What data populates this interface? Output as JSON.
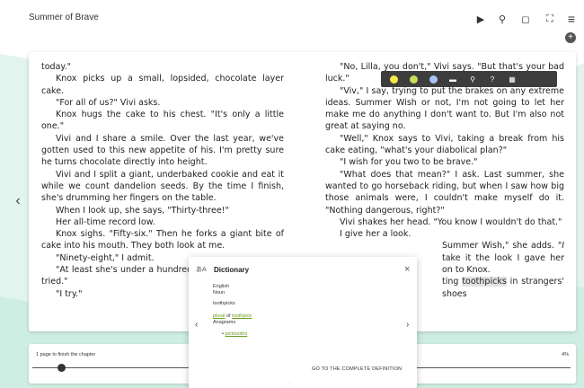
{
  "header": {
    "book_title": "Summer of Brave",
    "icons": [
      "play-icon",
      "search-icon",
      "bookmark-icon",
      "fullscreen-icon",
      "menu-icon"
    ],
    "play_glyph": "▶",
    "search_glyph": "⚲",
    "bookmark_glyph": "◻",
    "fullscreen_glyph": "⛶",
    "menu_glyph": "≡",
    "add_glyph": "+"
  },
  "nav": {
    "prev_glyph": "‹"
  },
  "left_column": [
    {
      "text": "today.\"",
      "noindent": true
    },
    {
      "text": "Knox picks up a small, lopsided, chocolate layer cake."
    },
    {
      "text": "\"For all of us?\" Vivi asks."
    },
    {
      "text": "Knox hugs the cake to his chest. \"It's only a little one.\""
    },
    {
      "text": "Vivi and I share a smile. Over the last year, we've gotten used to this new appetite of his. I'm pretty sure he turns chocolate directly into height."
    },
    {
      "text": "Vivi and I split a giant, underbaked cookie and eat it while we count dandelion seeds. By the time I finish, she's drumming her fingers on the table."
    },
    {
      "text": "When I look up, she says, \"Thirty-three!\""
    },
    {
      "text": "Her all-time record low."
    },
    {
      "text": "Knox sighs. \"Fifty-six.\" Then he forks a giant bite of cake into his mouth. They both look at me."
    },
    {
      "text": "\"Ninety-eight,\" I admit."
    },
    {
      "text": "\"At least she's under a hundred\" \"It's almost like she tried.\""
    },
    {
      "text": "\"I try.\""
    }
  ],
  "right_column": {
    "p1": "\"No, Lilla, you don't,\" Vivi says. \"But that's your bad luck.\"",
    "p2": "\"Viv,\" I say, trying to put the brakes on any extreme ideas. Summer Wish or not, I'm not going to let her make me do anything I don't want to. But I'm also not great at saying no.",
    "p3": "\"Well,\" Knox says to Vivi, taking a break from his cake eating, \"what's your diabolical plan?\"",
    "p4": "\"I wish for you two to be brave.\"",
    "p5": "\"What does that mean?\" I ask. Last summer, she wanted to go horseback riding, but when I saw how big those animals were, I couldn't make myself do it. \"Nothing dangerous, right?\"",
    "p6": "Vivi shakes her head. \"You know I wouldn't do that.\"",
    "p7": "I give her a look.",
    "p8_lead": "Summer Wish,\" she adds. \"",
    "p8_italic": "I",
    "p8_tail": " take it the look I gave her on to Knox.",
    "p9_lead": "ting ",
    "p9_highlight": "toothpicks",
    "p9_tail": " in strangers' shoes"
  },
  "highlight_toolbar": {
    "colors": [
      "#f6e94a",
      "#c7dd5a",
      "#a9c4f5"
    ],
    "note_glyph": "▬",
    "search_glyph": "⚲",
    "help_glyph": "?",
    "dict_glyph": "▦"
  },
  "dictionary": {
    "lang_icon": "あA",
    "title": "Dictionary",
    "close": "×",
    "language": "English",
    "pos": "Noun",
    "headword": "toothpicks",
    "plural_of_prefix": "plural",
    "plural_of_middle": " of ",
    "plural_of_link": "toothpick",
    "anagrams_label": "Anagrams",
    "anagram": "picktooths",
    "prev": "‹",
    "next": "›",
    "full_definition": "GO TO THE COMPLETE DEFINITION",
    "dots": "· · ·"
  },
  "progress": {
    "label": "1 page to finish the chapter",
    "percent_text": "4%",
    "fraction": 0.04
  }
}
